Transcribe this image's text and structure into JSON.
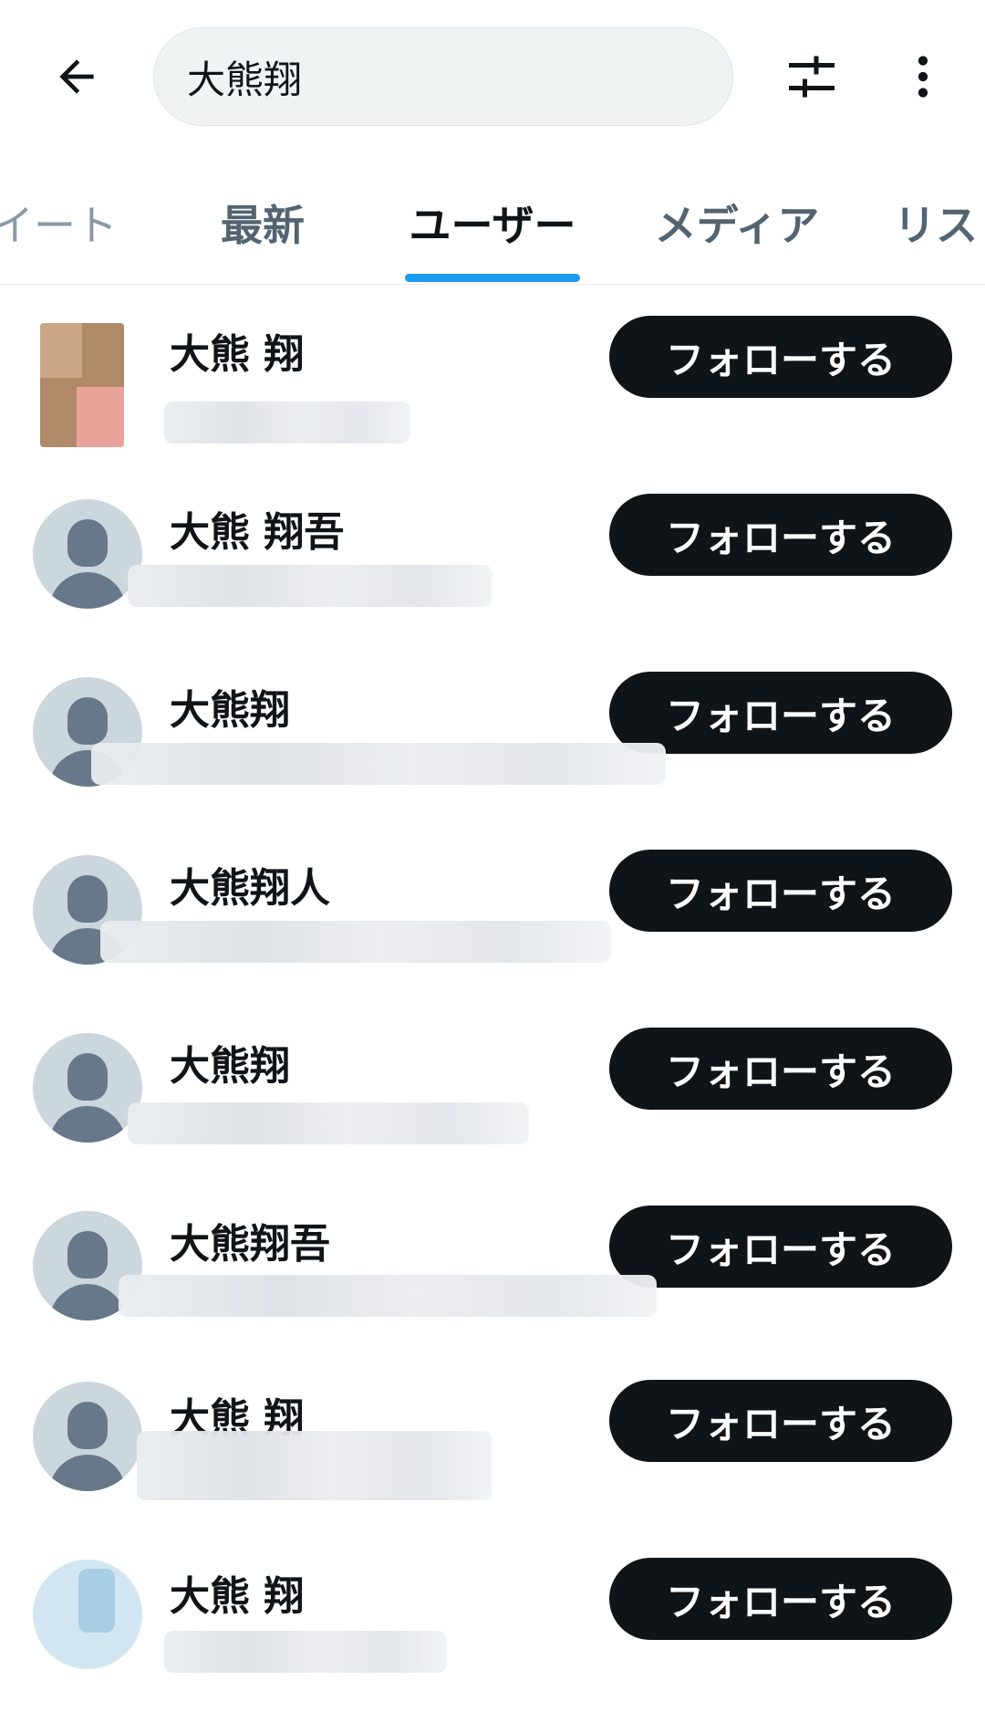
{
  "header": {
    "back_icon": "arrow-left-icon",
    "search_value": "大熊翔",
    "filter_icon": "sliders-icon",
    "more_icon": "vertical-ellipsis-icon"
  },
  "tabs": [
    {
      "label": "イート",
      "active": false
    },
    {
      "label": "最新",
      "active": false
    },
    {
      "label": "ユーザー",
      "active": true
    },
    {
      "label": "メディア",
      "active": false
    },
    {
      "label": "リス",
      "active": false
    }
  ],
  "colors": {
    "accent": "#1d9bf0",
    "button_bg": "#0f1419",
    "text_primary": "#0f1419",
    "text_secondary": "#536471"
  },
  "users": [
    {
      "name": "大熊 翔",
      "avatar": "photo",
      "follow_label": "フォローする"
    },
    {
      "name": "大熊 翔吾",
      "avatar": "default-avatar-icon",
      "follow_label": "フォローする"
    },
    {
      "name": "大熊翔",
      "avatar": "default-avatar-icon",
      "follow_label": "フォローする"
    },
    {
      "name": "大熊翔人",
      "avatar": "default-avatar-icon",
      "follow_label": "フォローする"
    },
    {
      "name": "大熊翔",
      "avatar": "default-avatar-icon",
      "follow_label": "フォローする"
    },
    {
      "name": "大熊翔吾",
      "avatar": "default-avatar-icon",
      "follow_label": "フォローする"
    },
    {
      "name": "大熊 翔",
      "avatar": "default-avatar-icon",
      "follow_label": "フォローする"
    },
    {
      "name": "大熊 翔",
      "avatar": "photo",
      "follow_label": "フォローする"
    }
  ]
}
